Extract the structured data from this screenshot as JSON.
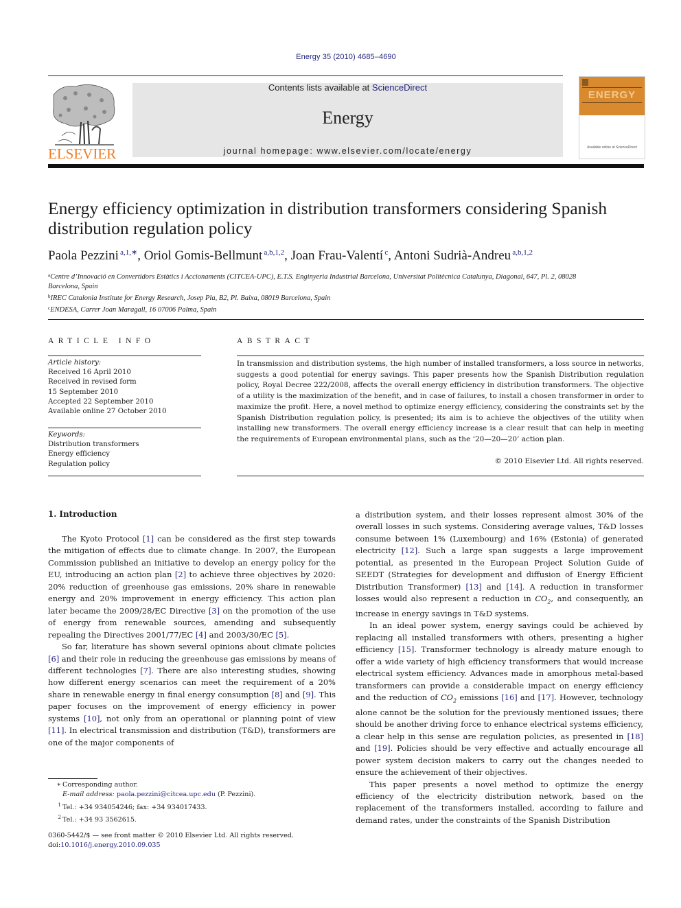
{
  "header": {
    "journal_ref": "Energy 35 (2010) 4685–4690",
    "contents_prefix": "Contents lists available at ",
    "contents_link": "ScienceDirect",
    "journal_name": "Energy",
    "homepage_line": "journal homepage: www.elsevier.com/locate/energy",
    "publisher_logo_text": "ELSEVIER",
    "cover_title": "ENERGY",
    "cover_footer": "Available online at ScienceDirect",
    "colors": {
      "publisher_orange": "#f07d22",
      "link_blue": "#24247e",
      "banner_grey": "#e6e6e6",
      "cover_orange": "#d98a2e"
    }
  },
  "article": {
    "title": "Energy efficiency optimization in distribution transformers considering Spanish distribution regulation policy",
    "authors": [
      {
        "name": "Paola Pezzini",
        "marks": "a,1,∗"
      },
      {
        "name": "Oriol Gomis-Bellmunt",
        "marks": "a,b,1,2"
      },
      {
        "name": "Joan Frau-Valentí",
        "marks": "c"
      },
      {
        "name": "Antoni Sudrià-Andreu",
        "marks": "a,b,1,2"
      }
    ],
    "affiliations": [
      {
        "mark": "a",
        "text": "Centre d’Innovació en Convertidors Estàtics i Accionaments (CITCEA-UPC), E.T.S. Enginyeria Industrial Barcelona, Universitat Politècnica Catalunya, Diagonal, 647, Pl. 2, 08028 Barcelona, Spain"
      },
      {
        "mark": "b",
        "text": "IREC Catalonia Institute for Energy Research, Josep Pla, B2, Pl. Baixa, 08019 Barcelona, Spain"
      },
      {
        "mark": "c",
        "text": "ENDESA, Carrer Joan Maragall, 16 07006 Palma, Spain"
      }
    ]
  },
  "article_info": {
    "heading": "ARTICLE INFO",
    "history_label": "Article history:",
    "history": [
      "Received 16 April 2010",
      "Received in revised form",
      "15 September 2010",
      "Accepted 22 September 2010",
      "Available online 27 October 2010"
    ],
    "keywords_label": "Keywords:",
    "keywords": [
      "Distribution transformers",
      "Energy efficiency",
      "Regulation policy"
    ]
  },
  "abstract": {
    "heading": "ABSTRACT",
    "text": "In transmission and distribution systems, the high number of installed transformers, a loss source in networks, suggests a good potential for energy savings. This paper presents how the Spanish Distribution regulation policy, Royal Decree 222/2008, affects the overall energy efficiency in distribution trans­formers. The objective of a utility is the maximization of the benefit, and in case of failures, to install a chosen transformer in order to maximize the profit. Here, a novel method to optimize energy efficiency, considering the constraints set by the Spanish Distribution regulation policy, is presented; its aim is to achieve the objectives of the utility when installing new transformers. The overall energy efficiency increase is a clear result that can help in meeting the requirements of European environmental plans, such as the ‘20—20—20’ action plan.",
    "copyright": "© 2010 Elsevier Ltd. All rights reserved."
  },
  "body": {
    "section_heading": "1.  Introduction",
    "left_paragraphs": [
      [
        {
          "t": "The Kyoto Protocol "
        },
        {
          "r": "[1]"
        },
        {
          "t": " can be considered as the first step towards the mitigation of effects due to climate change. In 2007, the European Commission published an initiative to develop an energy policy for the EU, introducing an action plan "
        },
        {
          "r": "[2]"
        },
        {
          "t": " to achieve three objectives by 2020: 20% reduction of greenhouse gas emissions, 20% share in renewable energy and 20% improvement in energy efficiency. This action plan later became the 2009/28/EC Directive "
        },
        {
          "r": "[3]"
        },
        {
          "t": " on the promotion of the use of energy from renewable sources, amending and subsequently repealing the Directives 2001/77/EC "
        },
        {
          "r": "[4]"
        },
        {
          "t": " and 2003/30/EC "
        },
        {
          "r": "[5]"
        },
        {
          "t": "."
        }
      ],
      [
        {
          "t": "So far, literature has shown several opinions about climate poli­cies "
        },
        {
          "r": "[6]"
        },
        {
          "t": " and their role in reducing the greenhouse gas emissions by means of different technologies "
        },
        {
          "r": "[7]"
        },
        {
          "t": ". There are also interesting studies, showing how different energy scenarios can meet the requirement of a 20% share in renewable energy in final energy consumption "
        },
        {
          "r": "[8]"
        },
        {
          "t": " and "
        },
        {
          "r": "[9]"
        },
        {
          "t": ". This paper focuses on the improvement of energy efficiency in power systems "
        },
        {
          "r": "[10]"
        },
        {
          "t": ", not only from an opera­tional or planning point of view "
        },
        {
          "r": "[11]"
        },
        {
          "t": ". In electrical transmission and distribution (T&D), transformers are one of the major components of"
        }
      ]
    ],
    "right_paragraphs": [
      [
        {
          "t": "a distribution system, and their losses represent almost 30% of the overall losses in such systems. Considering average values, T&D losses consume between 1% (Luxembourg) and 16% (Estonia) of generated electricity "
        },
        {
          "r": "[12]"
        },
        {
          "t": ". Such a large span suggests a large improvement potential, as presented in the European Project Solu­tion Guide of SEEDT (Strategies for development and diffusion of Energy Efficient Distribution Transformer) "
        },
        {
          "r": "[13]"
        },
        {
          "t": " and "
        },
        {
          "r": "[14]"
        },
        {
          "t": ". A reduction in transformer losses would also represent a reduction in "
        },
        {
          "co2": "CO"
        },
        {
          "t": ", and consequently, an increase in energy savings in T&D systems."
        }
      ],
      [
        {
          "t": "In an ideal power system, energy savings could be achieved by replacing all installed transformers with others, presenting a higher efficiency "
        },
        {
          "r": "[15]"
        },
        {
          "t": ". Transformer technology is already mature enough to offer a wide variety of high efficiency transformers that would increase electrical system efficiency. Advances made in amorphous metal-based transformers can provide a considerable impact on energy efficiency and the reduction of "
        },
        {
          "co2": "CO"
        },
        {
          "t": " emissions "
        },
        {
          "r": "[16]"
        },
        {
          "t": " and "
        },
        {
          "r": "[17]"
        },
        {
          "t": ". However, technology alone cannot be the solution for the previously mentioned issues; there should be another driving force to enhance electrical systems efficiency, a clear help in this sense are regulation policies, as presented in "
        },
        {
          "r": "[18]"
        },
        {
          "t": " and "
        },
        {
          "r": "[19]"
        },
        {
          "t": ". Policies should be very effective and actually encourage all power system decision makers to carry out the changes needed to ensure the achievement of their objectives."
        }
      ],
      [
        {
          "t": "This paper presents a novel method to optimize the energy efficiency of the electricity distribution network, based on the replacement of the transformers installed, according to failure and demand rates, under the constraints of the Spanish Distribution"
        }
      ]
    ]
  },
  "footnotes": {
    "corresponding_mark": "∗",
    "corresponding_text": "Corresponding author.",
    "email_label": "E-mail address: ",
    "email": "paola.pezzini@citcea.upc.edu",
    "email_suffix": " (P. Pezzini).",
    "notes": [
      {
        "mark": "1",
        "text": "Tel.: +34 934054246; fax: +34 934017433."
      },
      {
        "mark": "2",
        "text": "Tel.: +34 93 3562615."
      }
    ]
  },
  "front_matter": {
    "issn_line": "0360-5442/$ — see front matter © 2010 Elsevier Ltd. All rights reserved.",
    "doi_label": "doi:",
    "doi": "10.1016/j.energy.2010.09.035"
  }
}
